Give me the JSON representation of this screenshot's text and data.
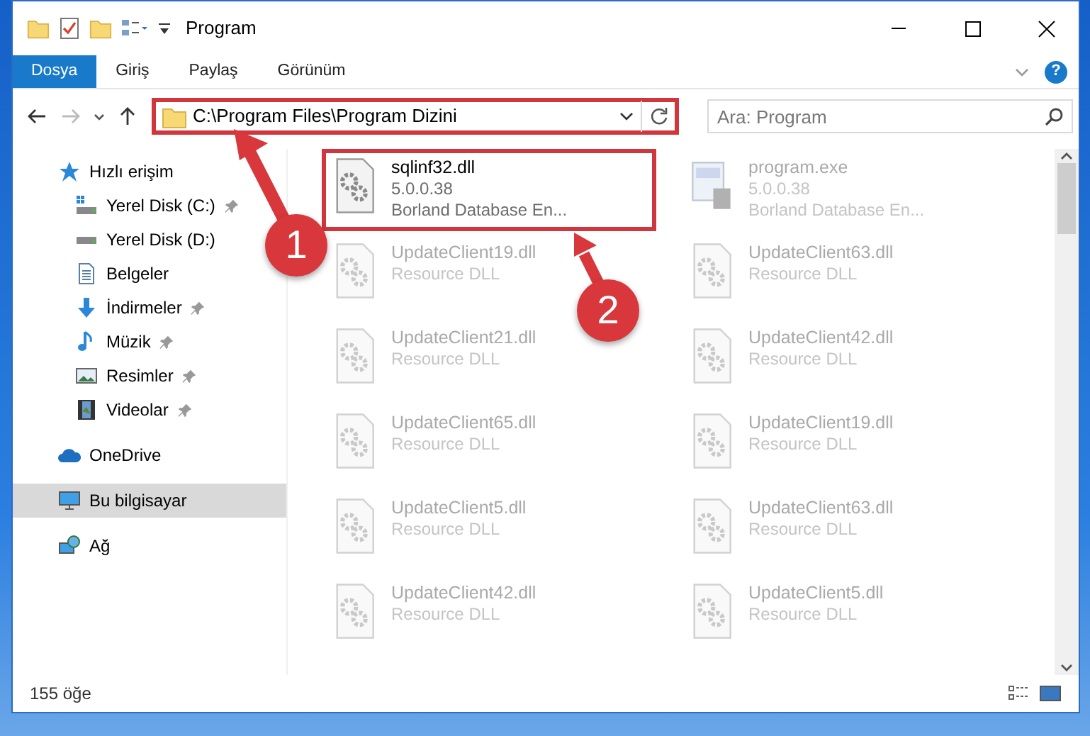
{
  "window": {
    "title": "Program"
  },
  "ribbon_tabs": [
    {
      "label": "Dosya",
      "kind": "file",
      "selected": false
    },
    {
      "label": "Giriş",
      "kind": "tab",
      "selected": false
    },
    {
      "label": "Paylaş",
      "kind": "tab",
      "selected": false
    },
    {
      "label": "Görünüm",
      "kind": "tab",
      "selected": false
    }
  ],
  "help": "?",
  "address": {
    "path": "C:\\Program Files\\Program Dizini",
    "highlighted": true
  },
  "search": {
    "placeholder": "Ara: Program"
  },
  "sidebar": {
    "items": [
      {
        "label": "Hızlı erişim",
        "kind": "star",
        "pinned": false,
        "selected": false,
        "children": [
          {
            "label": "Yerel Disk (C:)",
            "kind": "drive-c",
            "pinned": true,
            "selected": false
          },
          {
            "label": "Yerel Disk (D:)",
            "kind": "drive",
            "pinned": false,
            "selected": false
          },
          {
            "label": "Belgeler",
            "kind": "documents",
            "pinned": false,
            "selected": false
          },
          {
            "label": "İndirmeler",
            "kind": "download",
            "pinned": true,
            "selected": false
          },
          {
            "label": "Müzik",
            "kind": "music",
            "pinned": true,
            "selected": false
          },
          {
            "label": "Resimler",
            "kind": "pictures",
            "pinned": true,
            "selected": false
          },
          {
            "label": "Videolar",
            "kind": "videos",
            "pinned": true,
            "selected": false
          }
        ]
      },
      {
        "label": "OneDrive",
        "kind": "cloud",
        "pinned": false,
        "selected": false
      },
      {
        "label": "Bu bilgisayar",
        "kind": "computer",
        "pinned": false,
        "selected": true
      },
      {
        "label": "Ağ",
        "kind": "network",
        "pinned": false,
        "selected": false
      }
    ]
  },
  "files": [
    {
      "name": "sqlinf32.dll",
      "lines": [
        "5.0.0.38",
        "Borland Database En..."
      ],
      "kind": "dll",
      "faded": false,
      "highlighted": true
    },
    {
      "name": "program.exe",
      "lines": [
        "5.0.0.38",
        "Borland Database En..."
      ],
      "kind": "exe",
      "faded": true,
      "highlighted": false
    },
    {
      "name": "UpdateClient19.dll",
      "lines": [
        "Resource DLL"
      ],
      "kind": "dll",
      "faded": true,
      "highlighted": false
    },
    {
      "name": "UpdateClient63.dll",
      "lines": [
        "Resource DLL"
      ],
      "kind": "dll",
      "faded": true,
      "highlighted": false
    },
    {
      "name": "UpdateClient21.dll",
      "lines": [
        "Resource DLL"
      ],
      "kind": "dll",
      "faded": true,
      "highlighted": false
    },
    {
      "name": "UpdateClient42.dll",
      "lines": [
        "Resource DLL"
      ],
      "kind": "dll",
      "faded": true,
      "highlighted": false
    },
    {
      "name": "UpdateClient65.dll",
      "lines": [
        "Resource DLL"
      ],
      "kind": "dll",
      "faded": true,
      "highlighted": false
    },
    {
      "name": "UpdateClient19.dll",
      "lines": [
        "Resource DLL"
      ],
      "kind": "dll",
      "faded": true,
      "highlighted": false
    },
    {
      "name": "UpdateClient5.dll",
      "lines": [
        "Resource DLL"
      ],
      "kind": "dll",
      "faded": true,
      "highlighted": false
    },
    {
      "name": "UpdateClient63.dll",
      "lines": [
        "Resource DLL"
      ],
      "kind": "dll",
      "faded": true,
      "highlighted": false
    },
    {
      "name": "UpdateClient42.dll",
      "lines": [
        "Resource DLL"
      ],
      "kind": "dll",
      "faded": true,
      "highlighted": false
    },
    {
      "name": "UpdateClient5.dll",
      "lines": [
        "Resource DLL"
      ],
      "kind": "dll",
      "faded": true,
      "highlighted": false
    }
  ],
  "status_bar": {
    "count": "155 öğe"
  },
  "callouts": [
    "1",
    "2"
  ]
}
